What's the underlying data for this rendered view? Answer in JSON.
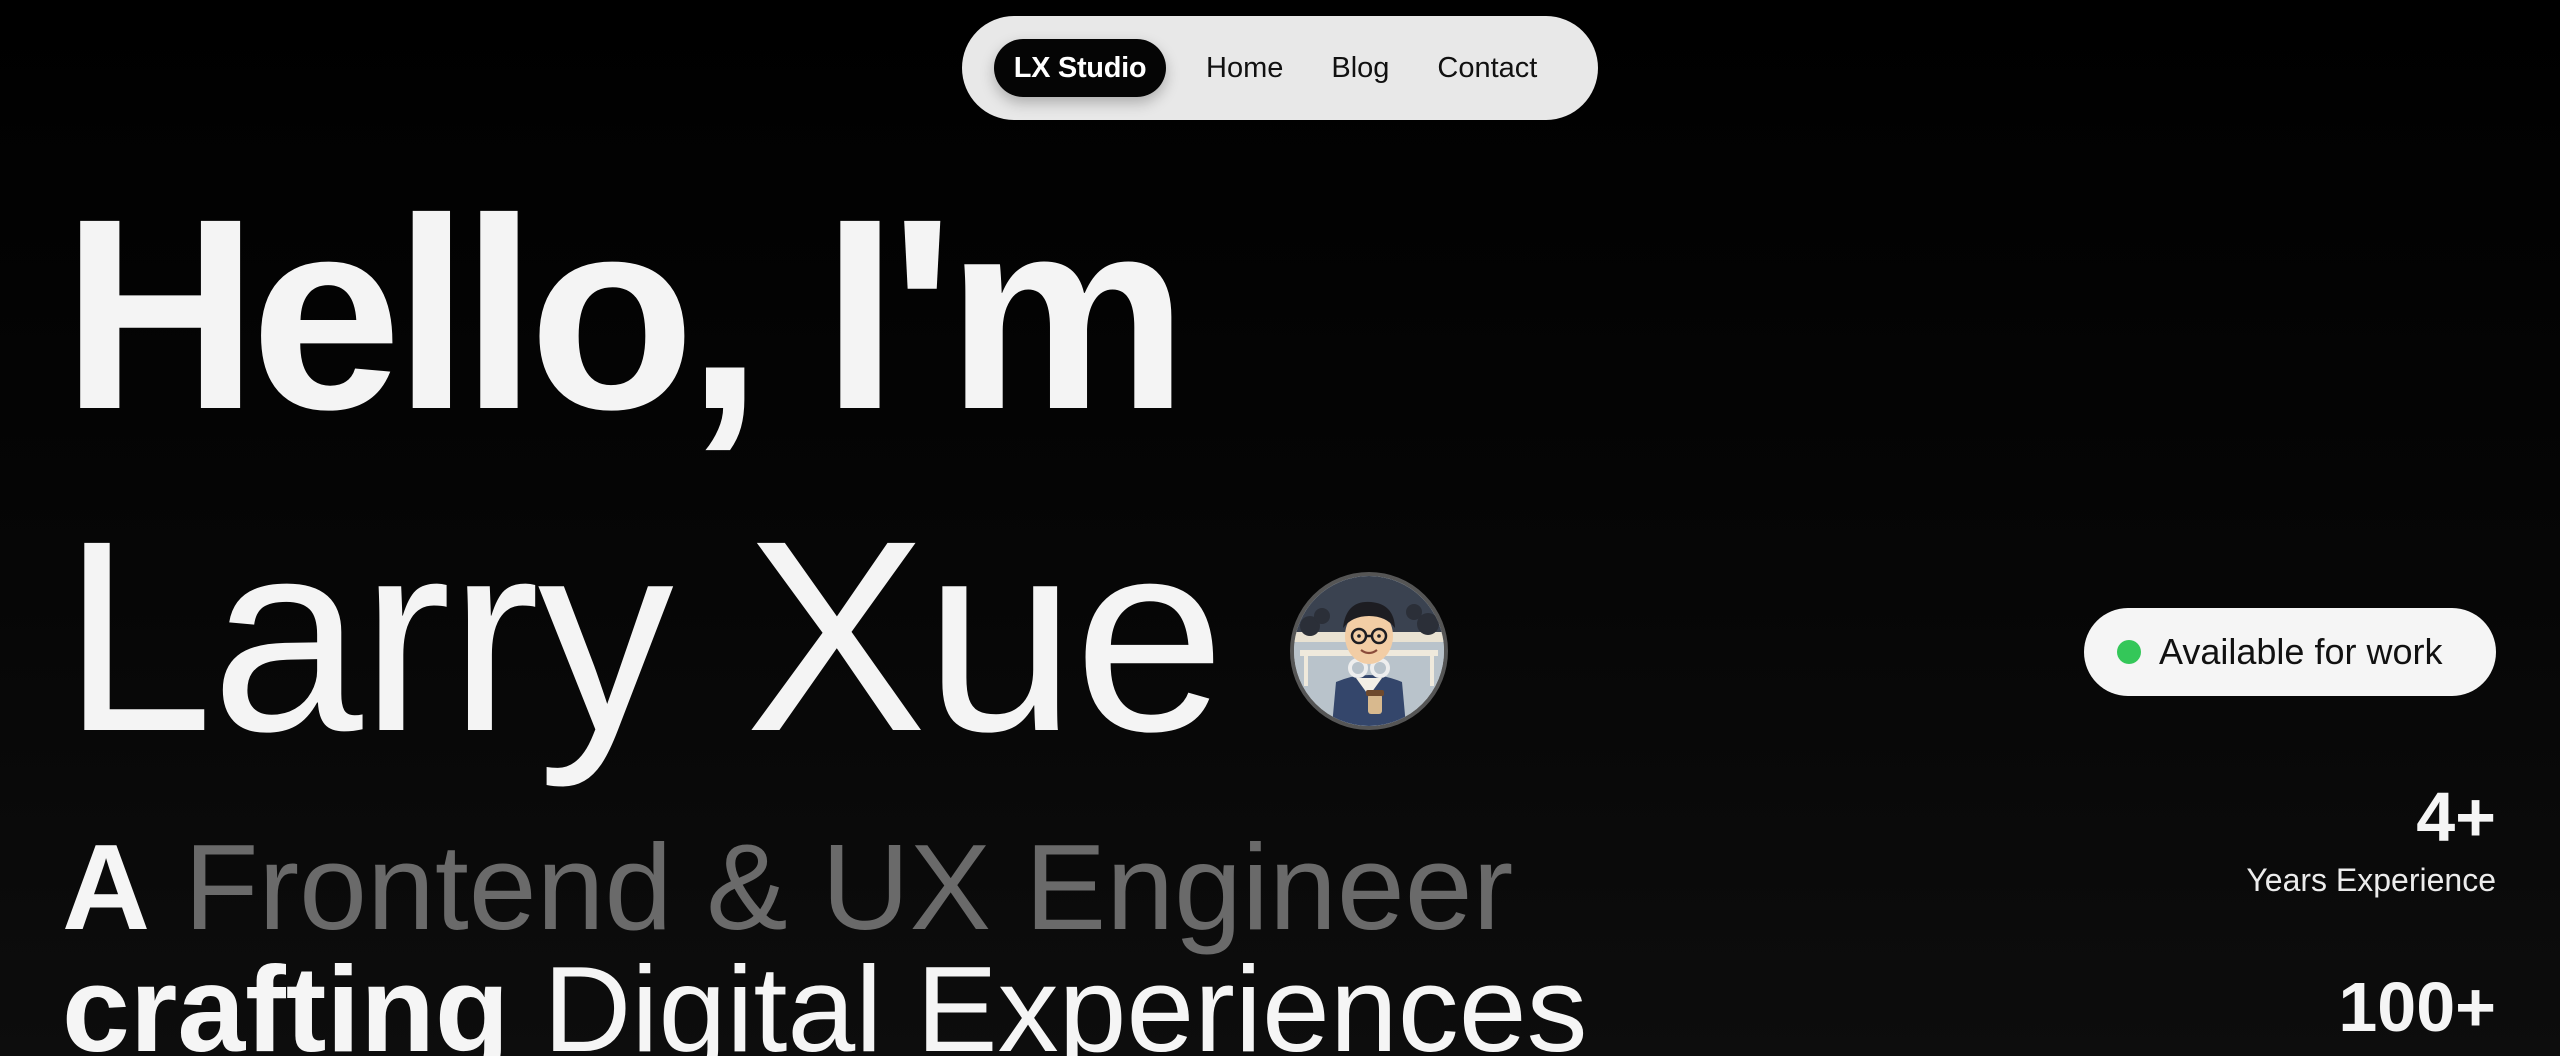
{
  "nav": {
    "brand": "LX Studio",
    "links": [
      "Home",
      "Blog",
      "Contact"
    ]
  },
  "hero": {
    "line1": "Hello, I'm",
    "line2": "Larry Xue",
    "tagline_part1_strong": "A",
    "tagline_part1_dim": "Frontend & UX Engineer",
    "tagline_part2_strong": "crafting",
    "tagline_part2_rest": "Digital Experiences"
  },
  "status": {
    "label": "Available for work",
    "dot_color": "#34c759"
  },
  "stats": [
    {
      "value": "4+",
      "label": "Years Experience"
    },
    {
      "value": "100+",
      "label": ""
    }
  ],
  "icons": {
    "avatar": "avatar-illustration"
  }
}
